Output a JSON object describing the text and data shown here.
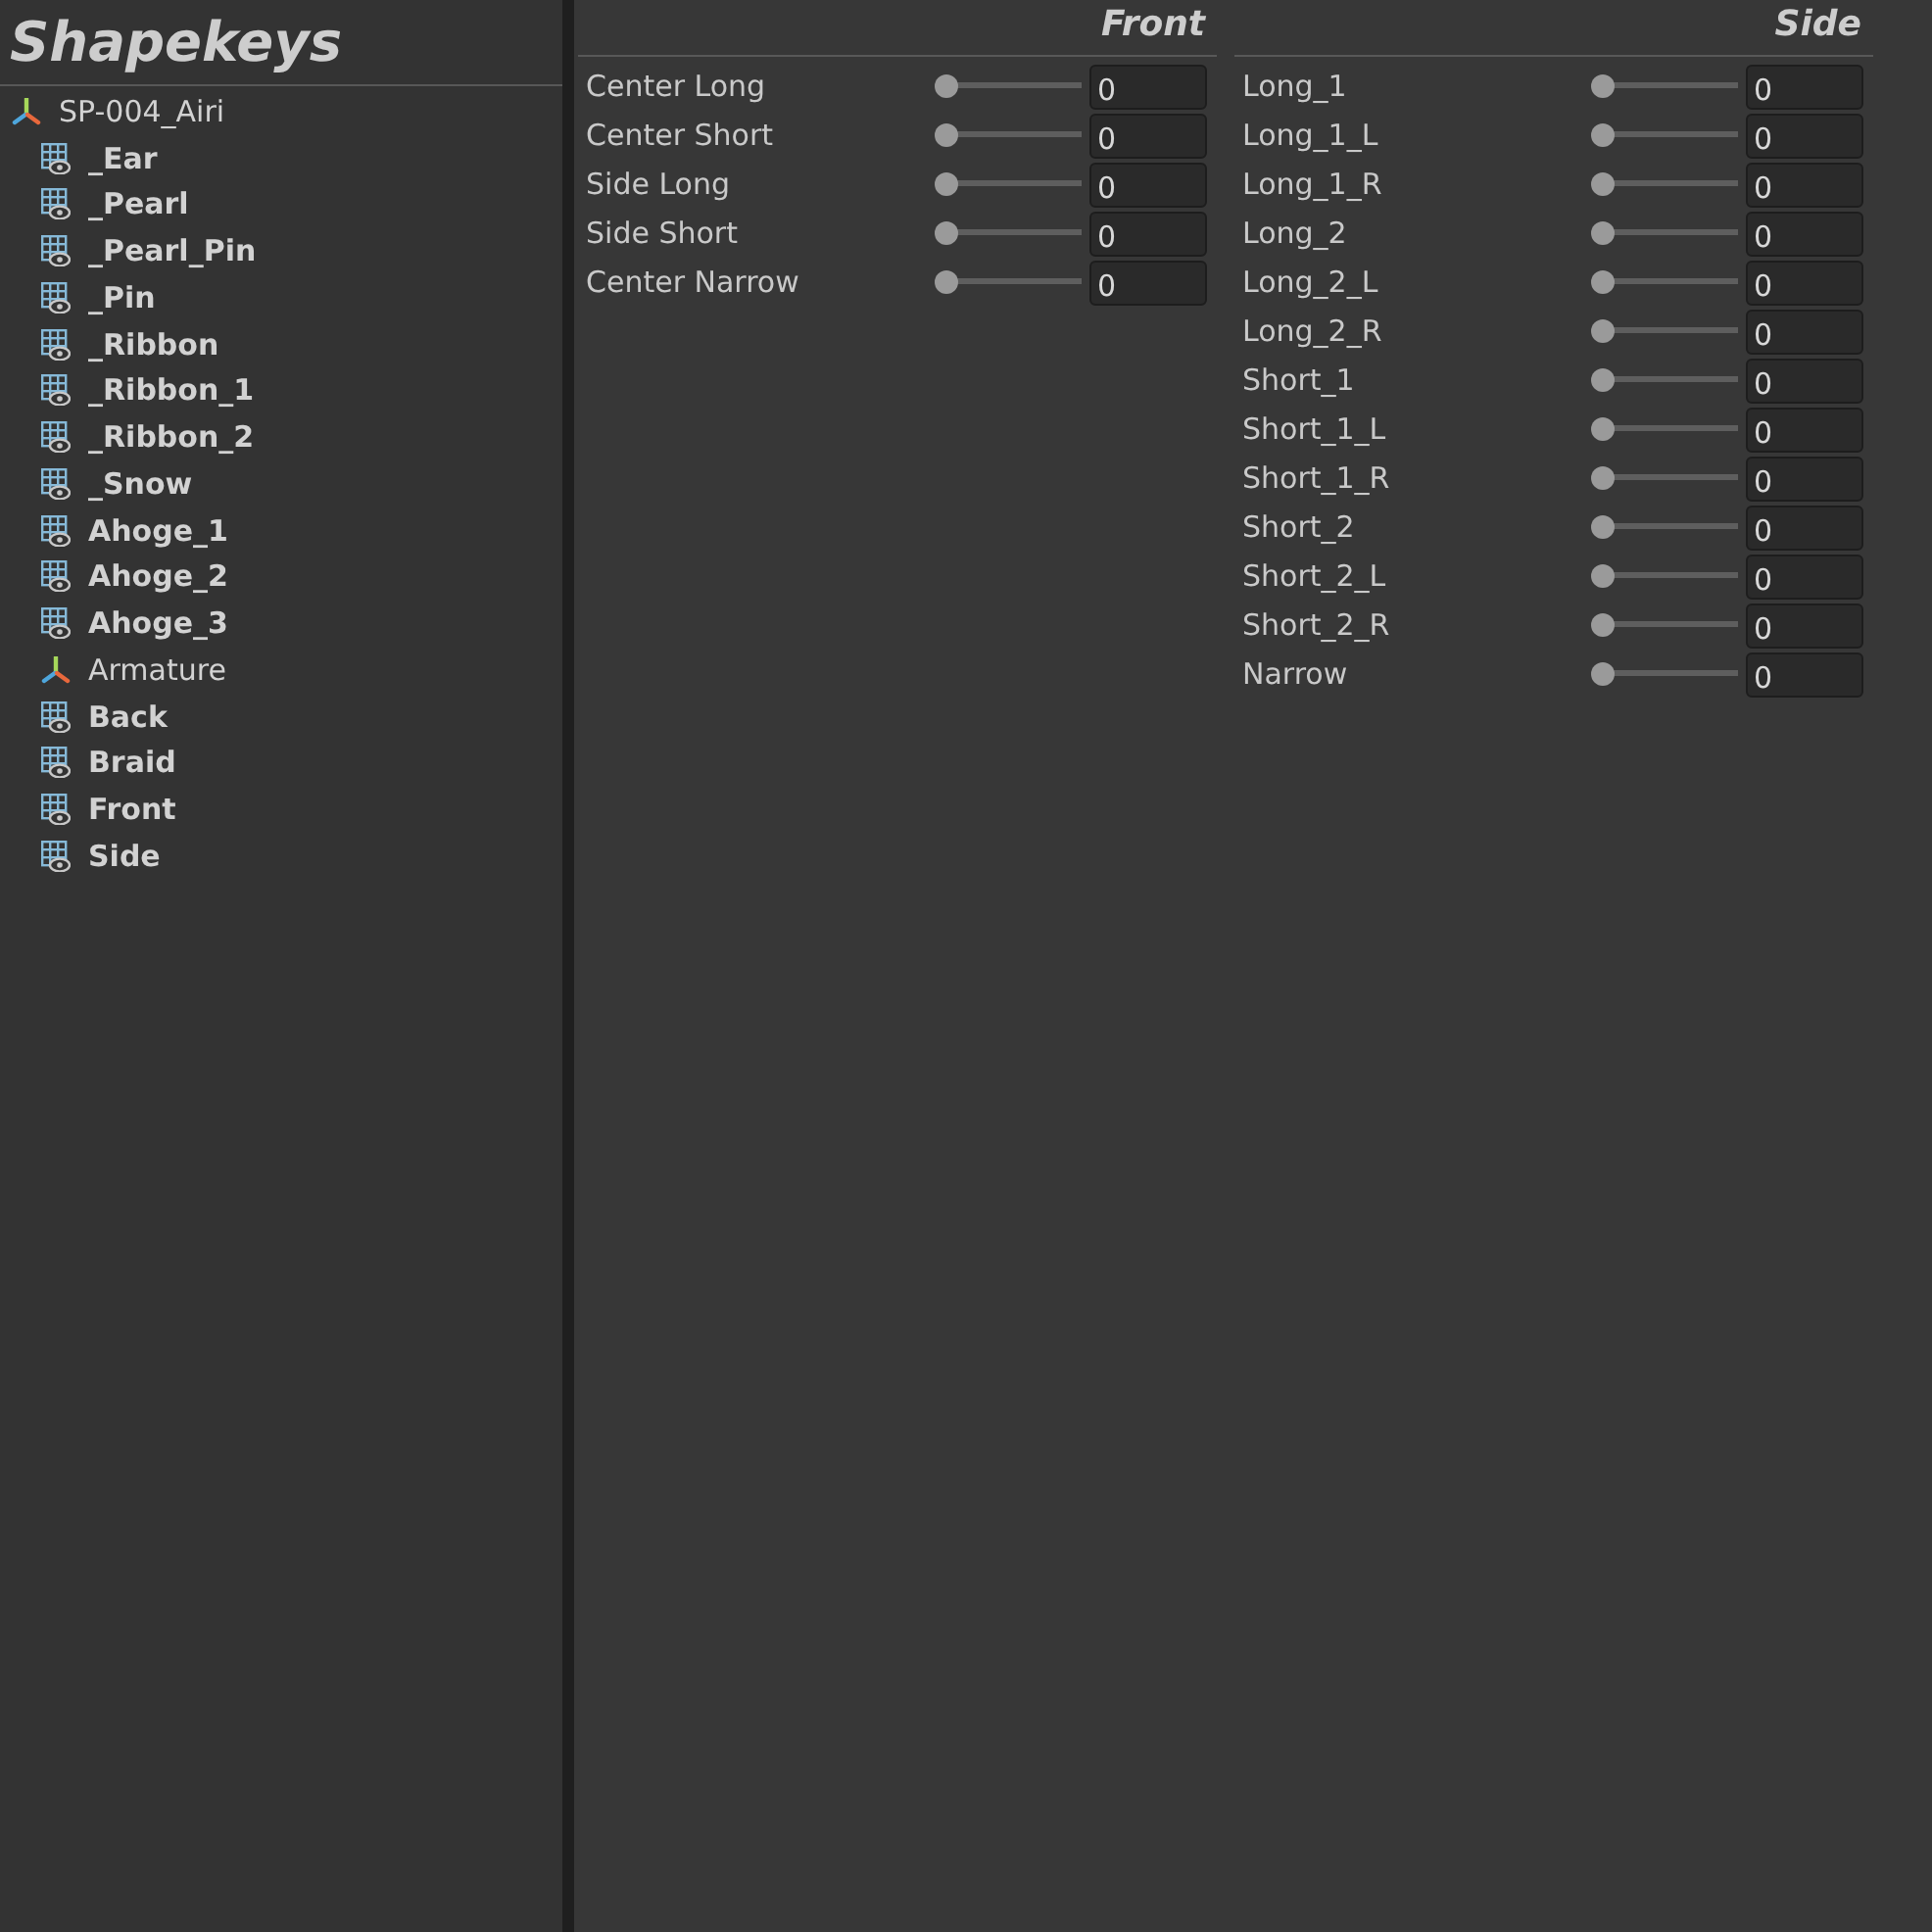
{
  "panel": {
    "title": "Shapekeys"
  },
  "tree": {
    "root": {
      "name": "SP-004_Airi",
      "kind": "armature",
      "children": [
        {
          "name": "_Ear",
          "kind": "mesh"
        },
        {
          "name": "_Pearl",
          "kind": "mesh"
        },
        {
          "name": "_Pearl_Pin",
          "kind": "mesh"
        },
        {
          "name": "_Pin",
          "kind": "mesh"
        },
        {
          "name": "_Ribbon",
          "kind": "mesh"
        },
        {
          "name": "_Ribbon_1",
          "kind": "mesh"
        },
        {
          "name": "_Ribbon_2",
          "kind": "mesh"
        },
        {
          "name": "_Snow",
          "kind": "mesh"
        },
        {
          "name": "Ahoge_1",
          "kind": "mesh"
        },
        {
          "name": "Ahoge_2",
          "kind": "mesh"
        },
        {
          "name": "Ahoge_3",
          "kind": "mesh"
        },
        {
          "name": "Armature",
          "kind": "armature"
        },
        {
          "name": "Back",
          "kind": "mesh"
        },
        {
          "name": "Braid",
          "kind": "mesh"
        },
        {
          "name": "Front",
          "kind": "mesh"
        },
        {
          "name": "Side",
          "kind": "mesh"
        }
      ]
    }
  },
  "groups": [
    {
      "title": "Front",
      "sliders": [
        {
          "label": "Center Long",
          "level": 0,
          "value": "0"
        },
        {
          "label": "Center Short",
          "level": 0,
          "value": "0"
        },
        {
          "label": "Side Long",
          "level": 0,
          "value": "0"
        },
        {
          "label": "Side Short",
          "level": 0,
          "value": "0"
        },
        {
          "label": "Center Narrow",
          "level": 0,
          "value": "0"
        }
      ]
    },
    {
      "title": "Side",
      "sliders": [
        {
          "label": "Long_1",
          "level": 0,
          "value": "0"
        },
        {
          "label": "Long_1_L",
          "level": 0,
          "value": "0"
        },
        {
          "label": "Long_1_R",
          "level": 0,
          "value": "0"
        },
        {
          "label": "Long_2",
          "level": 0,
          "value": "0"
        },
        {
          "label": "Long_2_L",
          "level": 0,
          "value": "0"
        },
        {
          "label": "Long_2_R",
          "level": 0,
          "value": "0"
        },
        {
          "label": "Short_1",
          "level": 0,
          "value": "0"
        },
        {
          "label": "Short_1_L",
          "level": 0,
          "value": "0"
        },
        {
          "label": "Short_1_R",
          "level": 0,
          "value": "0"
        },
        {
          "label": "Short_2",
          "level": 0,
          "value": "0"
        },
        {
          "label": "Short_2_L",
          "level": 0,
          "value": "0"
        },
        {
          "label": "Short_2_R",
          "level": 0,
          "value": "0"
        },
        {
          "label": "Narrow",
          "level": 0,
          "value": "0"
        }
      ]
    }
  ]
}
